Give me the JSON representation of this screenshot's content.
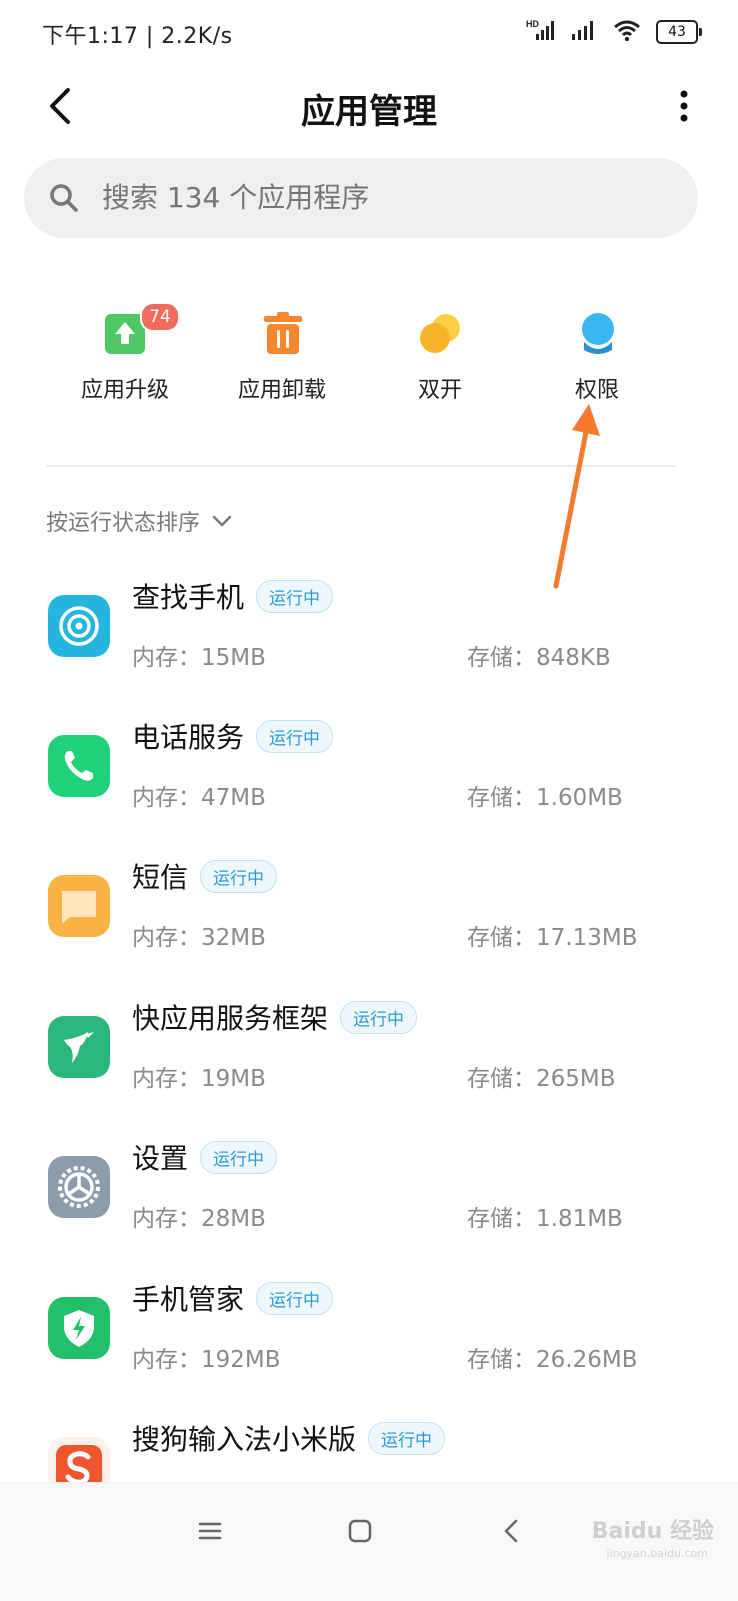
{
  "status_bar": {
    "time_speed": "下午1:17 | 2.2K/s",
    "network_type": "HD",
    "battery": "43"
  },
  "header": {
    "title": "应用管理"
  },
  "search": {
    "placeholder": "搜索 134 个应用程序"
  },
  "quick_actions": [
    {
      "label": "应用升级",
      "icon": "upgrade-icon",
      "badge": "74",
      "color": "#4cc764"
    },
    {
      "label": "应用卸载",
      "icon": "trash-icon",
      "color": "#f7862d"
    },
    {
      "label": "双开",
      "icon": "dual-app-icon",
      "color": "#f7b62a"
    },
    {
      "label": "权限",
      "icon": "permission-icon",
      "color": "#3ab6f2"
    }
  ],
  "sort": {
    "label": "按运行状态排序"
  },
  "apps": [
    {
      "name": "查找手机",
      "status": "运行中",
      "memory": "内存：15MB",
      "storage": "存储：848KB",
      "icon": "find-phone-icon"
    },
    {
      "name": "电话服务",
      "status": "运行中",
      "memory": "内存：47MB",
      "storage": "存储：1.60MB",
      "icon": "phone-icon"
    },
    {
      "name": "短信",
      "status": "运行中",
      "memory": "内存：32MB",
      "storage": "存储：17.13MB",
      "icon": "message-icon"
    },
    {
      "name": "快应用服务框架",
      "status": "运行中",
      "memory": "内存：19MB",
      "storage": "存储：265MB",
      "icon": "quick-app-icon"
    },
    {
      "name": "设置",
      "status": "运行中",
      "memory": "内存：28MB",
      "storage": "存储：1.81MB",
      "icon": "settings-icon"
    },
    {
      "name": "手机管家",
      "status": "运行中",
      "memory": "内存：192MB",
      "storage": "存储：26.26MB",
      "icon": "security-icon"
    },
    {
      "name": "搜狗输入法小米版",
      "status": "运行中",
      "icon": "sogou-icon"
    }
  ],
  "watermark": {
    "text": "Baidu 经验",
    "sub": "jingyan.baidu.com"
  },
  "colors": {
    "accent_arrow": "#f47a2e",
    "run_badge": "#2a9bd3"
  }
}
